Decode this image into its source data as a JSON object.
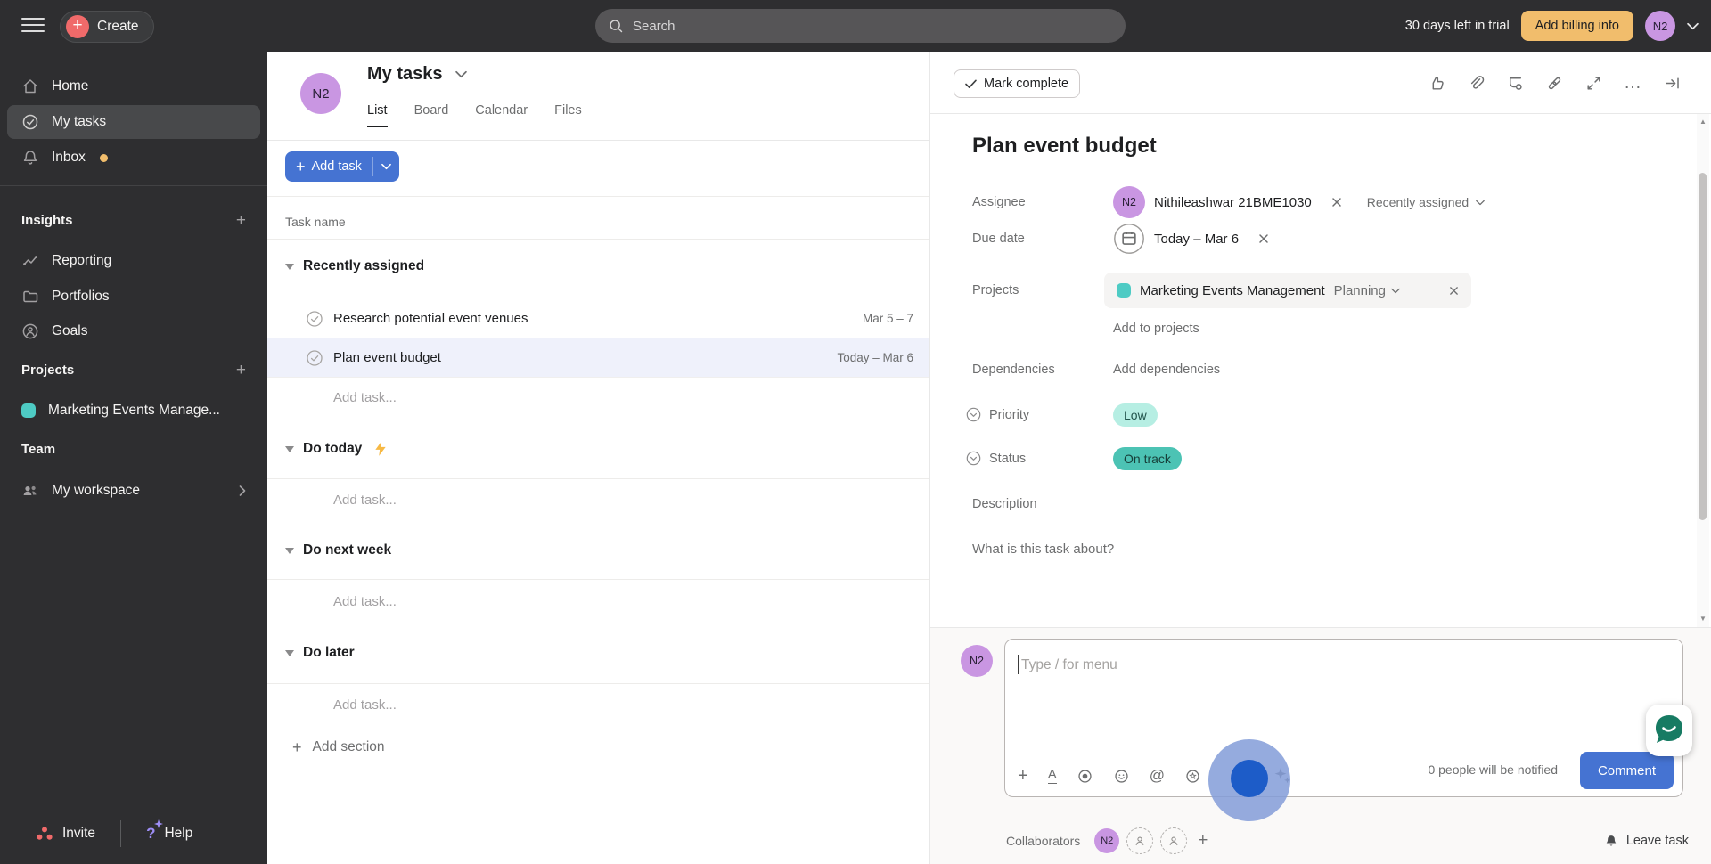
{
  "topbar": {
    "create_label": "Create",
    "search_placeholder": "Search",
    "trial_text": "30 days left in trial",
    "billing_label": "Add billing info",
    "avatar_initials": "N2"
  },
  "sidebar": {
    "items": [
      {
        "label": "Home"
      },
      {
        "label": "My tasks"
      },
      {
        "label": "Inbox"
      }
    ],
    "insights": {
      "header": "Insights",
      "items": [
        {
          "label": "Reporting"
        },
        {
          "label": "Portfolios"
        },
        {
          "label": "Goals"
        }
      ]
    },
    "projects": {
      "header": "Projects",
      "items": [
        {
          "label": "Marketing Events Manage...",
          "color": "#4ecbc4"
        }
      ]
    },
    "team": {
      "header": "Team",
      "items": [
        {
          "label": "My workspace"
        }
      ]
    },
    "footer": {
      "invite_label": "Invite",
      "help_label": "Help"
    }
  },
  "main": {
    "avatar_initials": "N2",
    "title": "My tasks",
    "tabs": [
      {
        "label": "List"
      },
      {
        "label": "Board"
      },
      {
        "label": "Calendar"
      },
      {
        "label": "Files"
      }
    ],
    "add_task_label": "Add task",
    "column_header": "Task name",
    "sections": [
      {
        "name": "Recently assigned",
        "tasks": [
          {
            "name": "Research potential event venues",
            "date": "Mar 5 – 7"
          },
          {
            "name": "Plan event budget",
            "date": "Today – Mar 6",
            "selected": true
          }
        ],
        "add_task_label": "Add task..."
      },
      {
        "name": "Do today",
        "add_task_label": "Add task..."
      },
      {
        "name": "Do next week",
        "add_task_label": "Add task..."
      },
      {
        "name": "Do later",
        "add_task_label": "Add task..."
      }
    ],
    "add_section_label": "Add section"
  },
  "panel": {
    "mark_complete_label": "Mark complete",
    "task_title": "Plan event budget",
    "assignee": {
      "label": "Assignee",
      "avatar_initials": "N2",
      "name": "Nithileashwar 21BME1030",
      "meta": "Recently assigned"
    },
    "due_date": {
      "label": "Due date",
      "value": "Today – Mar 6"
    },
    "projects": {
      "label": "Projects",
      "project_name": "Marketing Events Management",
      "section": "Planning",
      "add_label": "Add to projects"
    },
    "dependencies": {
      "label": "Dependencies",
      "add_label": "Add dependencies"
    },
    "priority": {
      "label": "Priority",
      "value": "Low"
    },
    "status": {
      "label": "Status",
      "value": "On track"
    },
    "description": {
      "label": "Description",
      "placeholder": "What is this task about?"
    }
  },
  "composer": {
    "avatar_initials": "N2",
    "placeholder": "Type / for menu",
    "notify_text": "0 people will be notified",
    "comment_label": "Comment",
    "collaborators_label": "Collaborators",
    "collaborator_initials": "N2",
    "leave_task_label": "Leave task"
  },
  "colors": {
    "accent_blue": "#4573d2",
    "brand_coral": "#f06a6a",
    "trial_yellow": "#f1bd6c",
    "avatar_purple": "#c996e2",
    "project_teal": "#4ecbc4",
    "priority_low_badge": "#b6eee3",
    "status_on_track_badge": "#4cc3b4",
    "notification_dot": "#f1bd6c",
    "selected_row": "#eff1fb",
    "topbar_bg": "#2e2e30"
  }
}
